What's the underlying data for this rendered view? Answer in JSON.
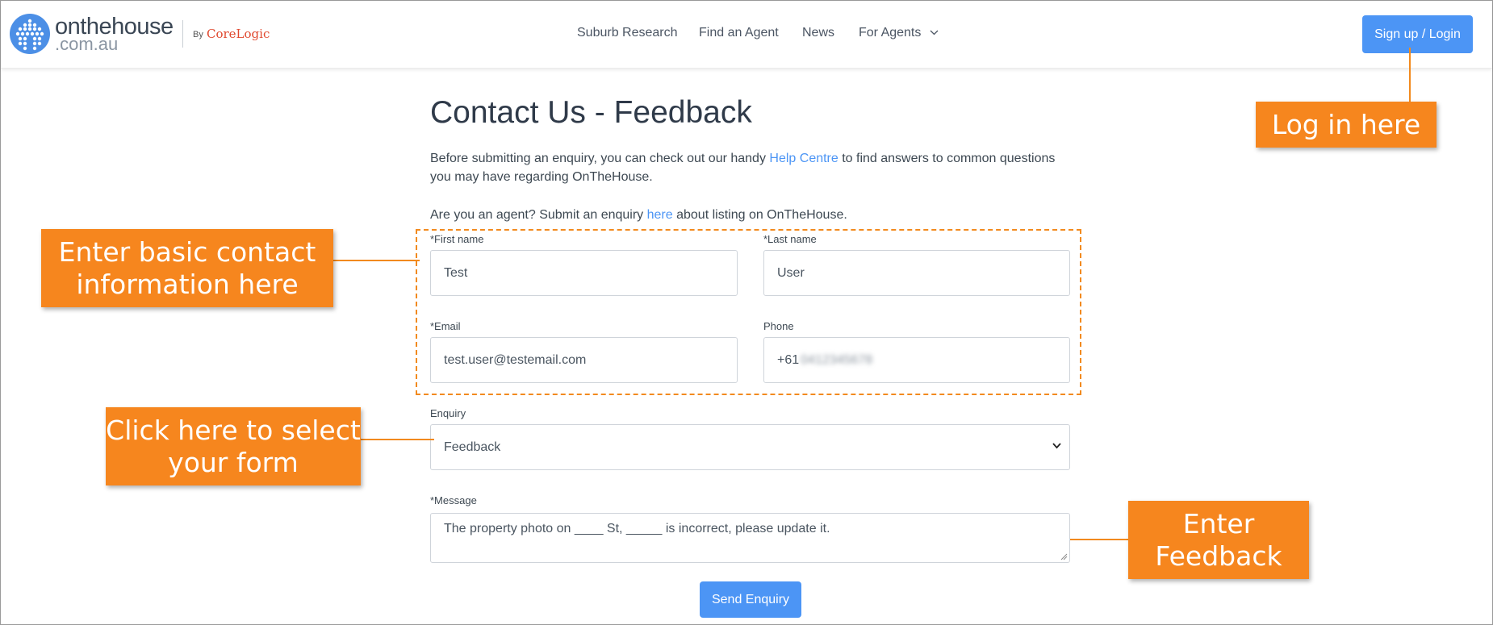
{
  "header": {
    "logo_main": "onthehouse",
    "logo_sub": ".com.au",
    "by": "By",
    "partner": "CoreLogic",
    "nav": [
      {
        "label": "Suburb Research"
      },
      {
        "label": "Find an Agent"
      },
      {
        "label": "News"
      },
      {
        "label": "For Agents"
      }
    ],
    "signup_label": "Sign up / Login"
  },
  "page": {
    "title": "Contact Us - Feedback",
    "intro_before": "Before submitting an enquiry, you can check out our handy ",
    "help_link": "Help Centre",
    "intro_after": " to find answers to common questions you may have regarding OnTheHouse.",
    "agent_before": "Are you an agent? Submit an enquiry ",
    "agent_link": "here",
    "agent_after": " about listing on OnTheHouse."
  },
  "form": {
    "first_name": {
      "label": "*First name",
      "value": "Test"
    },
    "last_name": {
      "label": "*Last name",
      "value": "User"
    },
    "email": {
      "label": "*Email",
      "value": "test.user@testemail.com"
    },
    "phone": {
      "label": "Phone",
      "prefix": "+61",
      "value_redacted": "0412345678"
    },
    "enquiry": {
      "label": "Enquiry",
      "value": "Feedback"
    },
    "message": {
      "label": "*Message",
      "value": "The property photo on ____ St, _____ is incorrect, please update it."
    },
    "submit_label": "Send Enquiry"
  },
  "annotations": {
    "login": "Log in here",
    "contact": "Enter basic contact information here",
    "select": "Click here to select your form",
    "feedback": "Enter Feedback"
  },
  "colors": {
    "accent_blue": "#4c95f5",
    "annotation_orange": "#f6861e",
    "brand_red": "#e0482e"
  },
  "icons": [
    "logo-dot-house-icon",
    "chevron-down-icon",
    "resize-grip-icon"
  ]
}
